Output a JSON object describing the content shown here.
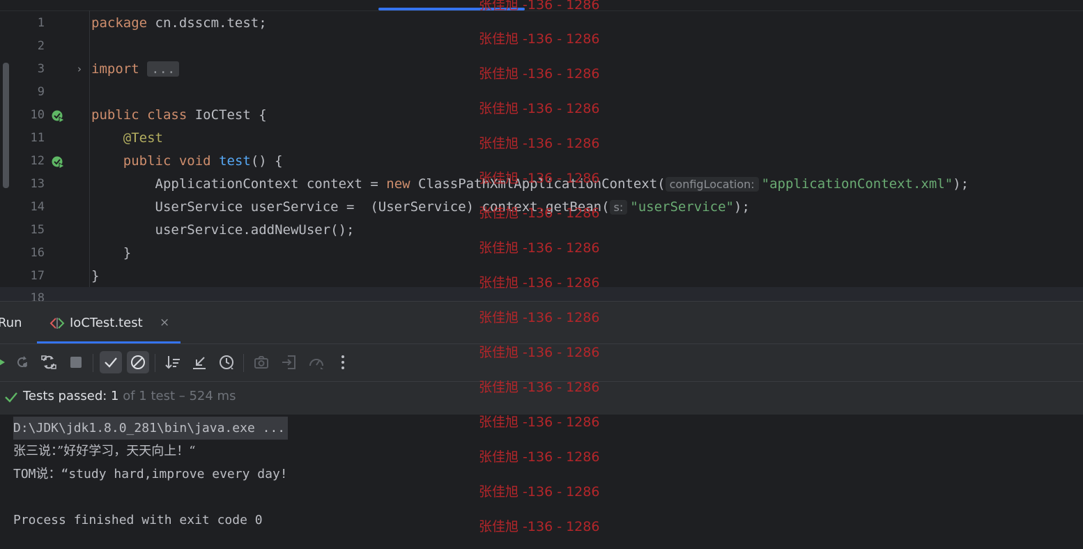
{
  "editor": {
    "lines": [
      {
        "num": "1",
        "code": ""
      },
      {
        "num": "2",
        "code": ""
      },
      {
        "num": "3",
        "code": ""
      },
      {
        "num": "9",
        "code": ""
      },
      {
        "num": "10",
        "code": ""
      },
      {
        "num": "11",
        "code": ""
      },
      {
        "num": "12",
        "code": ""
      },
      {
        "num": "13",
        "code": ""
      },
      {
        "num": "14",
        "code": ""
      },
      {
        "num": "15",
        "code": ""
      },
      {
        "num": "16",
        "code": ""
      },
      {
        "num": "17",
        "code": ""
      },
      {
        "num": "18",
        "code": ""
      }
    ],
    "tokens": {
      "l1_kw": "package",
      "l1_rest": " cn.dsscm.test;",
      "l3_kw": "import",
      "l3_fold": "...",
      "l10_kw": "public class",
      "l10_rest": " IoCTest {",
      "l11_ann": "@Test",
      "l12_kw": "public void",
      "l12_fn": "test",
      "l12_rest": "() {",
      "l13_a": "ApplicationContext context = ",
      "l13_kw": "new",
      "l13_b": " ClassPathXmlApplicationContext(",
      "l13_hint": "configLocation:",
      "l13_str": "\"applicationContext.xml\"",
      "l13_end": ");",
      "l14_a": "UserService userService =  (UserService) context.getBean(",
      "l14_hint": "s:",
      "l14_str": "\"userService\"",
      "l14_end": ");",
      "l15": "userService.addNewUser();",
      "l16": "}",
      "l17": "}"
    }
  },
  "run_panel": {
    "run_label": "Run",
    "tab_label": "IoCTest.test",
    "tab_close": "×",
    "status_passed": "Tests passed: 1",
    "status_detail": " of 1 test – 524 ms",
    "console": [
      "D:\\JDK\\jdk1.8.0_281\\bin\\java.exe ...",
      "张三说：”好好学习，天天向上！“",
      "TOM说：“study hard,improve every day!",
      "",
      "Process finished with exit code 0"
    ]
  },
  "watermark": "张佳旭 -136 - 1286",
  "colors": {
    "keyword": "#cf8e6d",
    "annotation": "#b3ae60",
    "function": "#56a8f5",
    "string": "#6aab73",
    "watermark": "#b4262a",
    "accent": "#3574f0",
    "pass_green": "#5fb865"
  },
  "icons": {
    "toolbar": [
      "rerun-icon",
      "rerun-failed-icon",
      "toggle-auto-test-icon",
      "stop-icon",
      "show-passed-icon",
      "show-ignored-icon",
      "sort-icon",
      "collapse-icon",
      "history-icon",
      "screenshot-icon",
      "import-tests-icon",
      "coverage-icon",
      "more-icon"
    ]
  }
}
